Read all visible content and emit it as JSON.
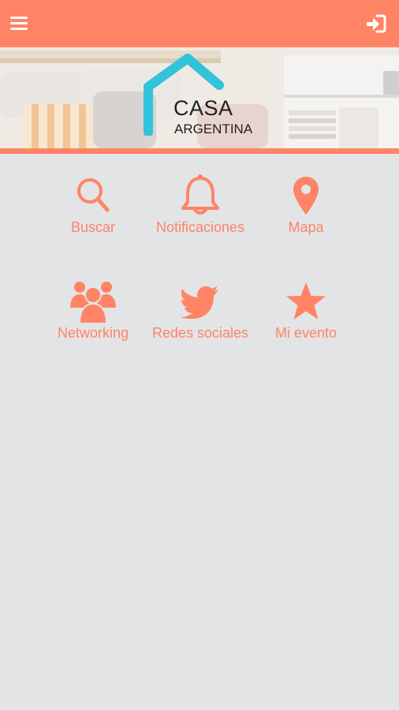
{
  "app": {
    "accent_color": "#ff8466",
    "background_color": "#e3e4e6",
    "topbar": {
      "left_icon": "menu-icon",
      "right_icon": "login-icon"
    },
    "banner": {
      "logo_line1": "CASA",
      "logo_line2": "ARGENTINA"
    },
    "grid": {
      "items": [
        {
          "label": "Buscar",
          "icon": "search-icon"
        },
        {
          "label": "Notificaciones",
          "icon": "bell-icon"
        },
        {
          "label": "Mapa",
          "icon": "map-pin-icon"
        },
        {
          "label": "Networking",
          "icon": "users-icon"
        },
        {
          "label": "Redes sociales",
          "icon": "twitter-icon"
        },
        {
          "label": "Mi evento",
          "icon": "star-icon"
        }
      ]
    }
  }
}
